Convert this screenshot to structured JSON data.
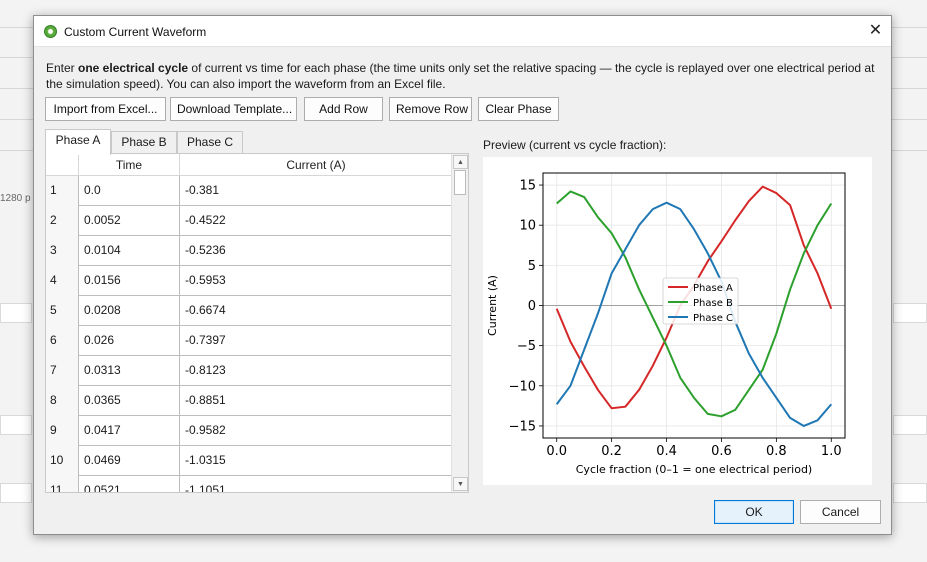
{
  "background": {
    "label": "1280 p"
  },
  "dialog": {
    "title": "Custom Current Waveform",
    "close_glyph": "✕",
    "intro_pre": "Enter ",
    "intro_bold": "one electrical cycle",
    "intro_post": " of current vs time for each phase (the time units only set the relative spacing — the cycle is replayed over one electrical period at the simulation speed). You can also import the waveform from an Excel file."
  },
  "toolbar": {
    "import_label": "Import from Excel...",
    "template_label": "Download Template...",
    "add_row_label": "Add Row",
    "remove_row_label": "Remove Row",
    "clear_phase_label": "Clear Phase"
  },
  "tabs": [
    {
      "label": "Phase A",
      "active": true
    },
    {
      "label": "Phase B",
      "active": false
    },
    {
      "label": "Phase C",
      "active": false
    }
  ],
  "table": {
    "columns": [
      "Time",
      "Current (A)"
    ],
    "rows": [
      {
        "n": "1",
        "time": "0.0",
        "current": "-0.381"
      },
      {
        "n": "2",
        "time": "0.0052",
        "current": "-0.4522"
      },
      {
        "n": "3",
        "time": "0.0104",
        "current": "-0.5236"
      },
      {
        "n": "4",
        "time": "0.0156",
        "current": "-0.5953"
      },
      {
        "n": "5",
        "time": "0.0208",
        "current": "-0.6674"
      },
      {
        "n": "6",
        "time": "0.026",
        "current": "-0.7397"
      },
      {
        "n": "7",
        "time": "0.0313",
        "current": "-0.8123"
      },
      {
        "n": "8",
        "time": "0.0365",
        "current": "-0.8851"
      },
      {
        "n": "9",
        "time": "0.0417",
        "current": "-0.9582"
      },
      {
        "n": "10",
        "time": "0.0469",
        "current": "-1.0315"
      },
      {
        "n": "11",
        "time": "0.0521",
        "current": "-1.1051"
      }
    ]
  },
  "preview": {
    "label": "Preview (current vs cycle fraction):"
  },
  "chart_data": {
    "type": "line",
    "xlabel": "Cycle fraction (0–1 = one electrical period)",
    "ylabel": "Current (A)",
    "xlim": [
      -0.05,
      1.05
    ],
    "ylim": [
      -16.5,
      16.5
    ],
    "xticks": [
      0.0,
      0.2,
      0.4,
      0.6,
      0.8,
      1.0
    ],
    "xtick_labels": [
      "0.0",
      "0.2",
      "0.4",
      "0.6",
      "0.8",
      "1.0"
    ],
    "yticks": [
      -15,
      -10,
      -5,
      0,
      5,
      10,
      15
    ],
    "ytick_labels": [
      "−15",
      "−10",
      "−5",
      "0",
      "5",
      "10",
      "15"
    ],
    "grid": true,
    "legend_position": "center-right",
    "x": [
      0,
      0.05,
      0.1,
      0.15,
      0.2,
      0.25,
      0.3,
      0.35,
      0.4,
      0.45,
      0.5,
      0.55,
      0.6,
      0.65,
      0.7,
      0.75,
      0.8,
      0.85,
      0.9,
      0.95,
      1.0
    ],
    "series": [
      {
        "name": "Phase A",
        "color": "#d62728",
        "values": [
          -0.4,
          -4.5,
          -7.6,
          -10.5,
          -12.8,
          -12.6,
          -10.5,
          -7.5,
          -4.0,
          0.0,
          2.5,
          5.5,
          8.0,
          10.6,
          13.0,
          14.8,
          14.0,
          12.5,
          7.5,
          4.0,
          -0.4
        ]
      },
      {
        "name": "Phase B",
        "color": "#2ca02c",
        "values": [
          12.7,
          14.2,
          13.5,
          11.0,
          9.0,
          6.0,
          2.0,
          -1.5,
          -5.0,
          -9.0,
          -11.5,
          -13.5,
          -13.8,
          -13.0,
          -10.5,
          -8.0,
          -3.5,
          2.0,
          6.5,
          10.0,
          12.7
        ]
      },
      {
        "name": "Phase C",
        "color": "#1f77b4",
        "values": [
          -12.3,
          -10.0,
          -5.5,
          -1.0,
          4.0,
          7.0,
          10.0,
          12.0,
          12.8,
          12.0,
          9.5,
          6.5,
          3.0,
          -2.0,
          -6.0,
          -9.0,
          -11.5,
          -14.0,
          -15.0,
          -14.3,
          -12.3
        ]
      }
    ]
  }
}
